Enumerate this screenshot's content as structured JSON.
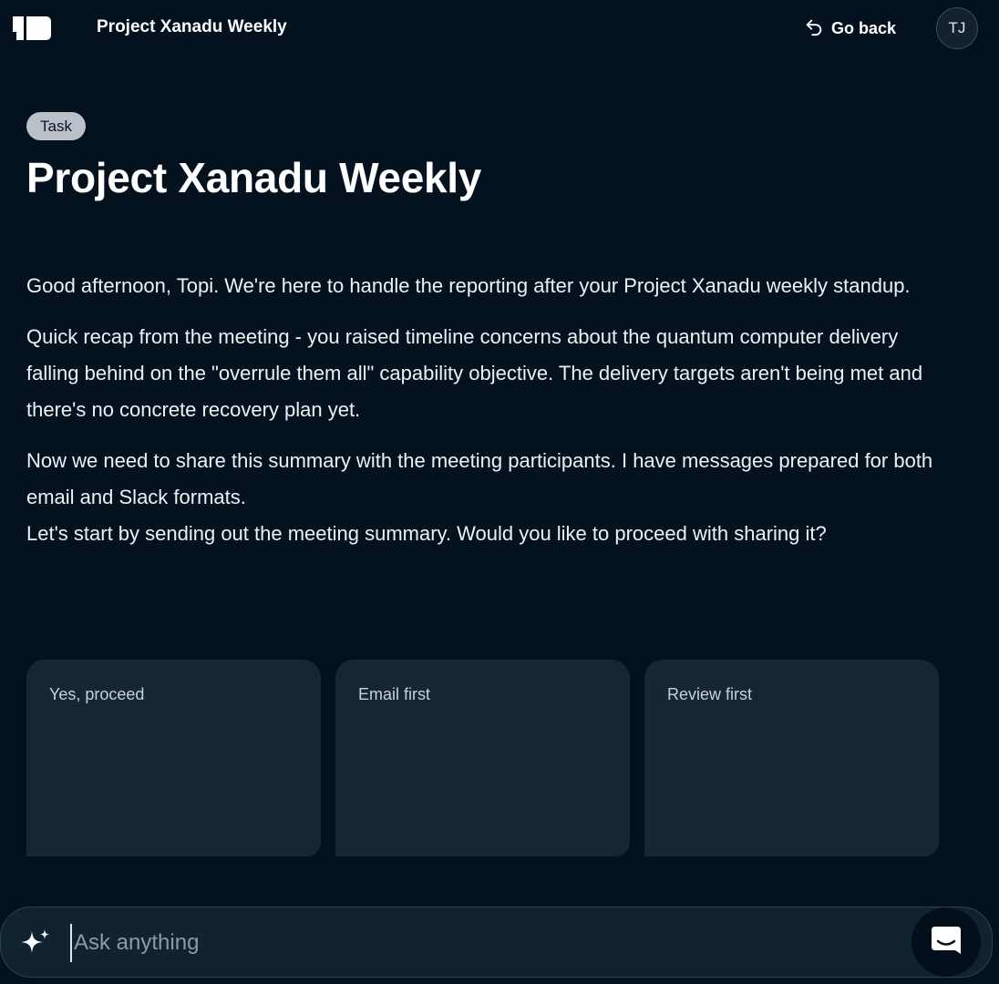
{
  "header": {
    "title": "Project Xanadu Weekly",
    "go_back_label": "Go back",
    "avatar_initials": "TJ",
    "logo_icon": "brand-logo-icon",
    "go_back_icon": "undo-arrow-icon"
  },
  "task": {
    "badge": "Task",
    "title": "Project Xanadu Weekly"
  },
  "message": {
    "paragraph_1": "Good afternoon, Topi. We're here to handle the reporting after your Project Xanadu weekly standup.",
    "paragraph_2": "Quick recap from the meeting - you raised timeline concerns about the quantum computer delivery falling behind on the \"overrule them all\" capability objective. The delivery targets aren't being met and there's no concrete recovery plan yet.",
    "paragraph_3": "Now we need to share this summary with the meeting participants. I have messages prepared for both email and Slack formats.",
    "paragraph_4": "Let's start by sending out the meeting summary. Would you like to proceed with sharing it?"
  },
  "options": [
    {
      "label": "Yes, proceed"
    },
    {
      "label": "Email first"
    },
    {
      "label": "Review first"
    }
  ],
  "chat": {
    "placeholder": "Ask anything",
    "value": "",
    "sparkle_icon": "sparkle-icon",
    "send_icon": "chat-bubble-icon"
  },
  "colors": {
    "background": "#04121f",
    "card": "#172634",
    "badge": "#b9c0c8",
    "input_bar": "#112330"
  }
}
